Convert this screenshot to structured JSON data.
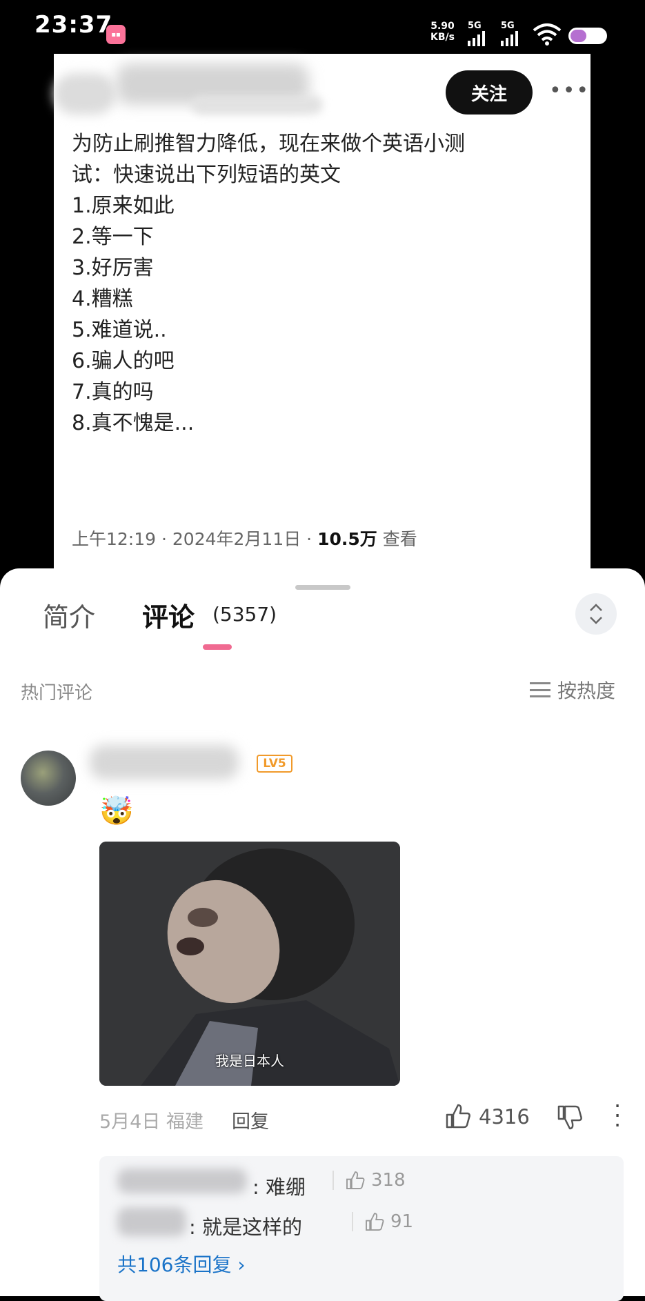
{
  "status_bar": {
    "time": "23:37",
    "app_icon": "bilibili-app-icon",
    "net_speed": "5.90",
    "net_unit": "KB/s",
    "signal_1": "5G",
    "signal_2": "5G",
    "battery_level": 0.45
  },
  "tweet": {
    "follow_label": "关注",
    "more_icon": "more-horizontal-icon",
    "text_lines": [
      "为防止刷推智力降低，现在来做个英语小测",
      "试：快速说出下列短语的英文",
      "1.原来如此",
      "2.等一下",
      "3.好厉害",
      "4.糟糕",
      "5.难道说..",
      "6.骗人的吧",
      "7.真的吗",
      "8.真不愧是..."
    ],
    "meta_prefix": "上午12:19 · 2024年2月11日 · ",
    "views": "10.5万",
    "views_suffix": " 查看"
  },
  "panel": {
    "tab_intro": "简介",
    "tab_comments": "评论",
    "comment_count": "(5357)",
    "accent_color": "#f06a91",
    "hot_label": "热门评论",
    "sort_label": "按热度"
  },
  "comment": {
    "level_badge": "LV5",
    "emoji": "🤯",
    "image_caption": "我是日本人",
    "date_location": "5月4日  福建",
    "reply_label": "回复",
    "likes": "4316",
    "replies": [
      {
        "text": ": 难绷",
        "likes": "318"
      },
      {
        "text": ": 就是这样的",
        "likes": "91"
      }
    ],
    "more_replies": "共106条回复 ›"
  }
}
